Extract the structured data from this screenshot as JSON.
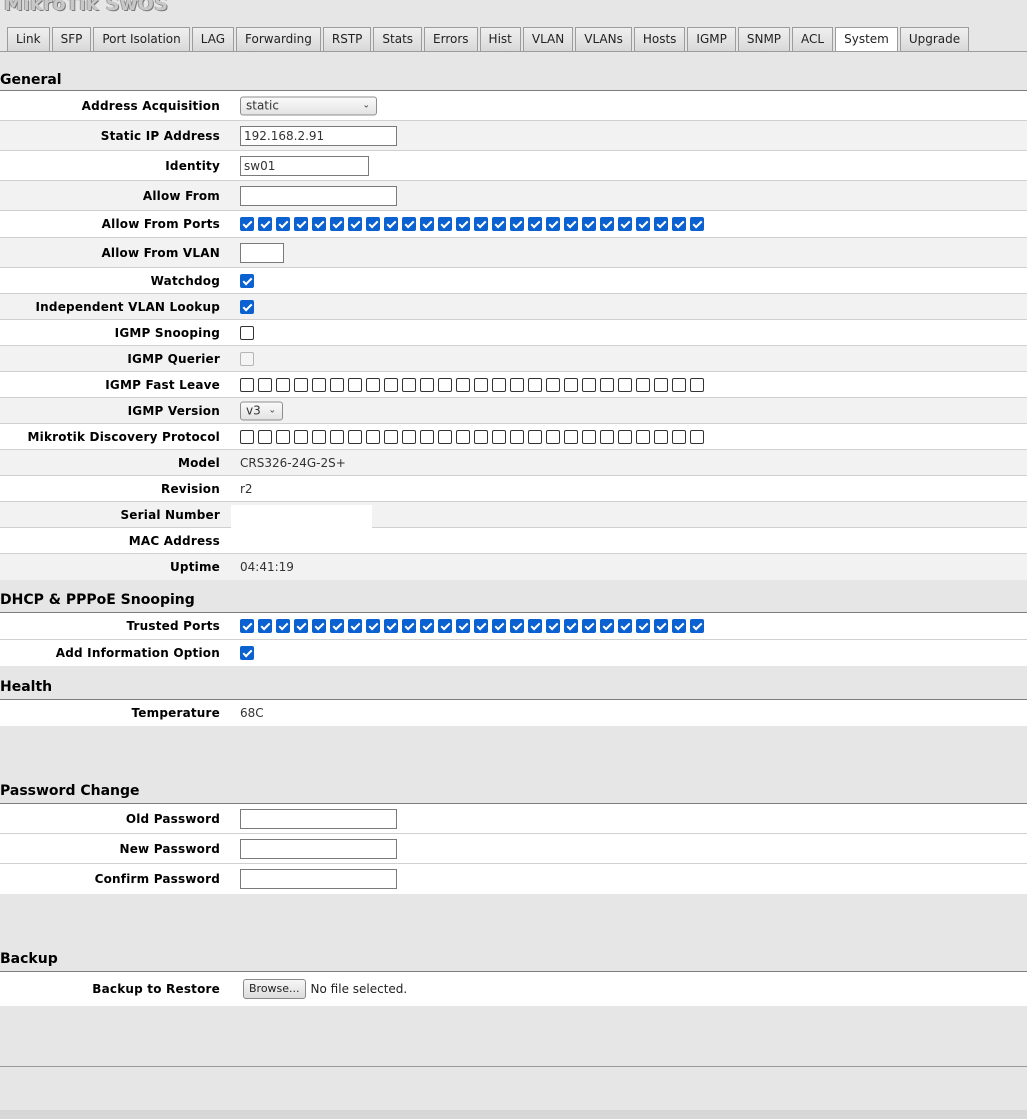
{
  "app": {
    "title": "MikroTik SwOS"
  },
  "tabs": [
    "Link",
    "SFP",
    "Port Isolation",
    "LAG",
    "Forwarding",
    "RSTP",
    "Stats",
    "Errors",
    "Hist",
    "VLAN",
    "VLANs",
    "Hosts",
    "IGMP",
    "SNMP",
    "ACL",
    "System",
    "Upgrade"
  ],
  "active_tab": "System",
  "general": {
    "title": "General",
    "address_acquisition": {
      "label": "Address Acquisition",
      "value": "static"
    },
    "static_ip": {
      "label": "Static IP Address",
      "value": "192.168.2.91"
    },
    "identity": {
      "label": "Identity",
      "value": "sw01"
    },
    "allow_from": {
      "label": "Allow From",
      "value": ""
    },
    "allow_from_ports": {
      "label": "Allow From Ports",
      "checked": [
        true,
        true,
        true,
        true,
        true,
        true,
        true,
        true,
        true,
        true,
        true,
        true,
        true,
        true,
        true,
        true,
        true,
        true,
        true,
        true,
        true,
        true,
        true,
        true,
        true,
        true
      ]
    },
    "allow_from_vlan": {
      "label": "Allow From VLAN",
      "value": ""
    },
    "watchdog": {
      "label": "Watchdog",
      "checked": true
    },
    "independent_vlan_lookup": {
      "label": "Independent VLAN Lookup",
      "checked": true
    },
    "igmp_snooping": {
      "label": "IGMP Snooping",
      "checked": false
    },
    "igmp_querier": {
      "label": "IGMP Querier",
      "checked": false,
      "disabled": true
    },
    "igmp_fast_leave": {
      "label": "IGMP Fast Leave",
      "checked": [
        false,
        false,
        false,
        false,
        false,
        false,
        false,
        false,
        false,
        false,
        false,
        false,
        false,
        false,
        false,
        false,
        false,
        false,
        false,
        false,
        false,
        false,
        false,
        false,
        false,
        false
      ]
    },
    "igmp_version": {
      "label": "IGMP Version",
      "value": "v3"
    },
    "mdp": {
      "label": "Mikrotik Discovery Protocol",
      "checked": [
        false,
        false,
        false,
        false,
        false,
        false,
        false,
        false,
        false,
        false,
        false,
        false,
        false,
        false,
        false,
        false,
        false,
        false,
        false,
        false,
        false,
        false,
        false,
        false,
        false,
        false
      ]
    },
    "model": {
      "label": "Model",
      "value": "CRS326-24G-2S+"
    },
    "revision": {
      "label": "Revision",
      "value": "r2"
    },
    "serial_number": {
      "label": "Serial Number",
      "value": ""
    },
    "mac_address": {
      "label": "MAC Address",
      "value": ""
    },
    "uptime": {
      "label": "Uptime",
      "value": "04:41:19"
    }
  },
  "dhcp": {
    "title": "DHCP & PPPoE Snooping",
    "trusted_ports": {
      "label": "Trusted Ports",
      "checked": [
        true,
        true,
        true,
        true,
        true,
        true,
        true,
        true,
        true,
        true,
        true,
        true,
        true,
        true,
        true,
        true,
        true,
        true,
        true,
        true,
        true,
        true,
        true,
        true,
        true,
        true
      ]
    },
    "add_information_option": {
      "label": "Add Information Option",
      "checked": true
    }
  },
  "health": {
    "title": "Health",
    "temperature": {
      "label": "Temperature",
      "value": "68C"
    }
  },
  "password": {
    "title": "Password Change",
    "old": {
      "label": "Old Password",
      "value": ""
    },
    "new": {
      "label": "New Password",
      "value": ""
    },
    "confirm": {
      "label": "Confirm Password",
      "value": ""
    }
  },
  "backup": {
    "title": "Backup",
    "restore": {
      "label": "Backup to Restore",
      "button": "Browse...",
      "status": "No file selected."
    }
  }
}
